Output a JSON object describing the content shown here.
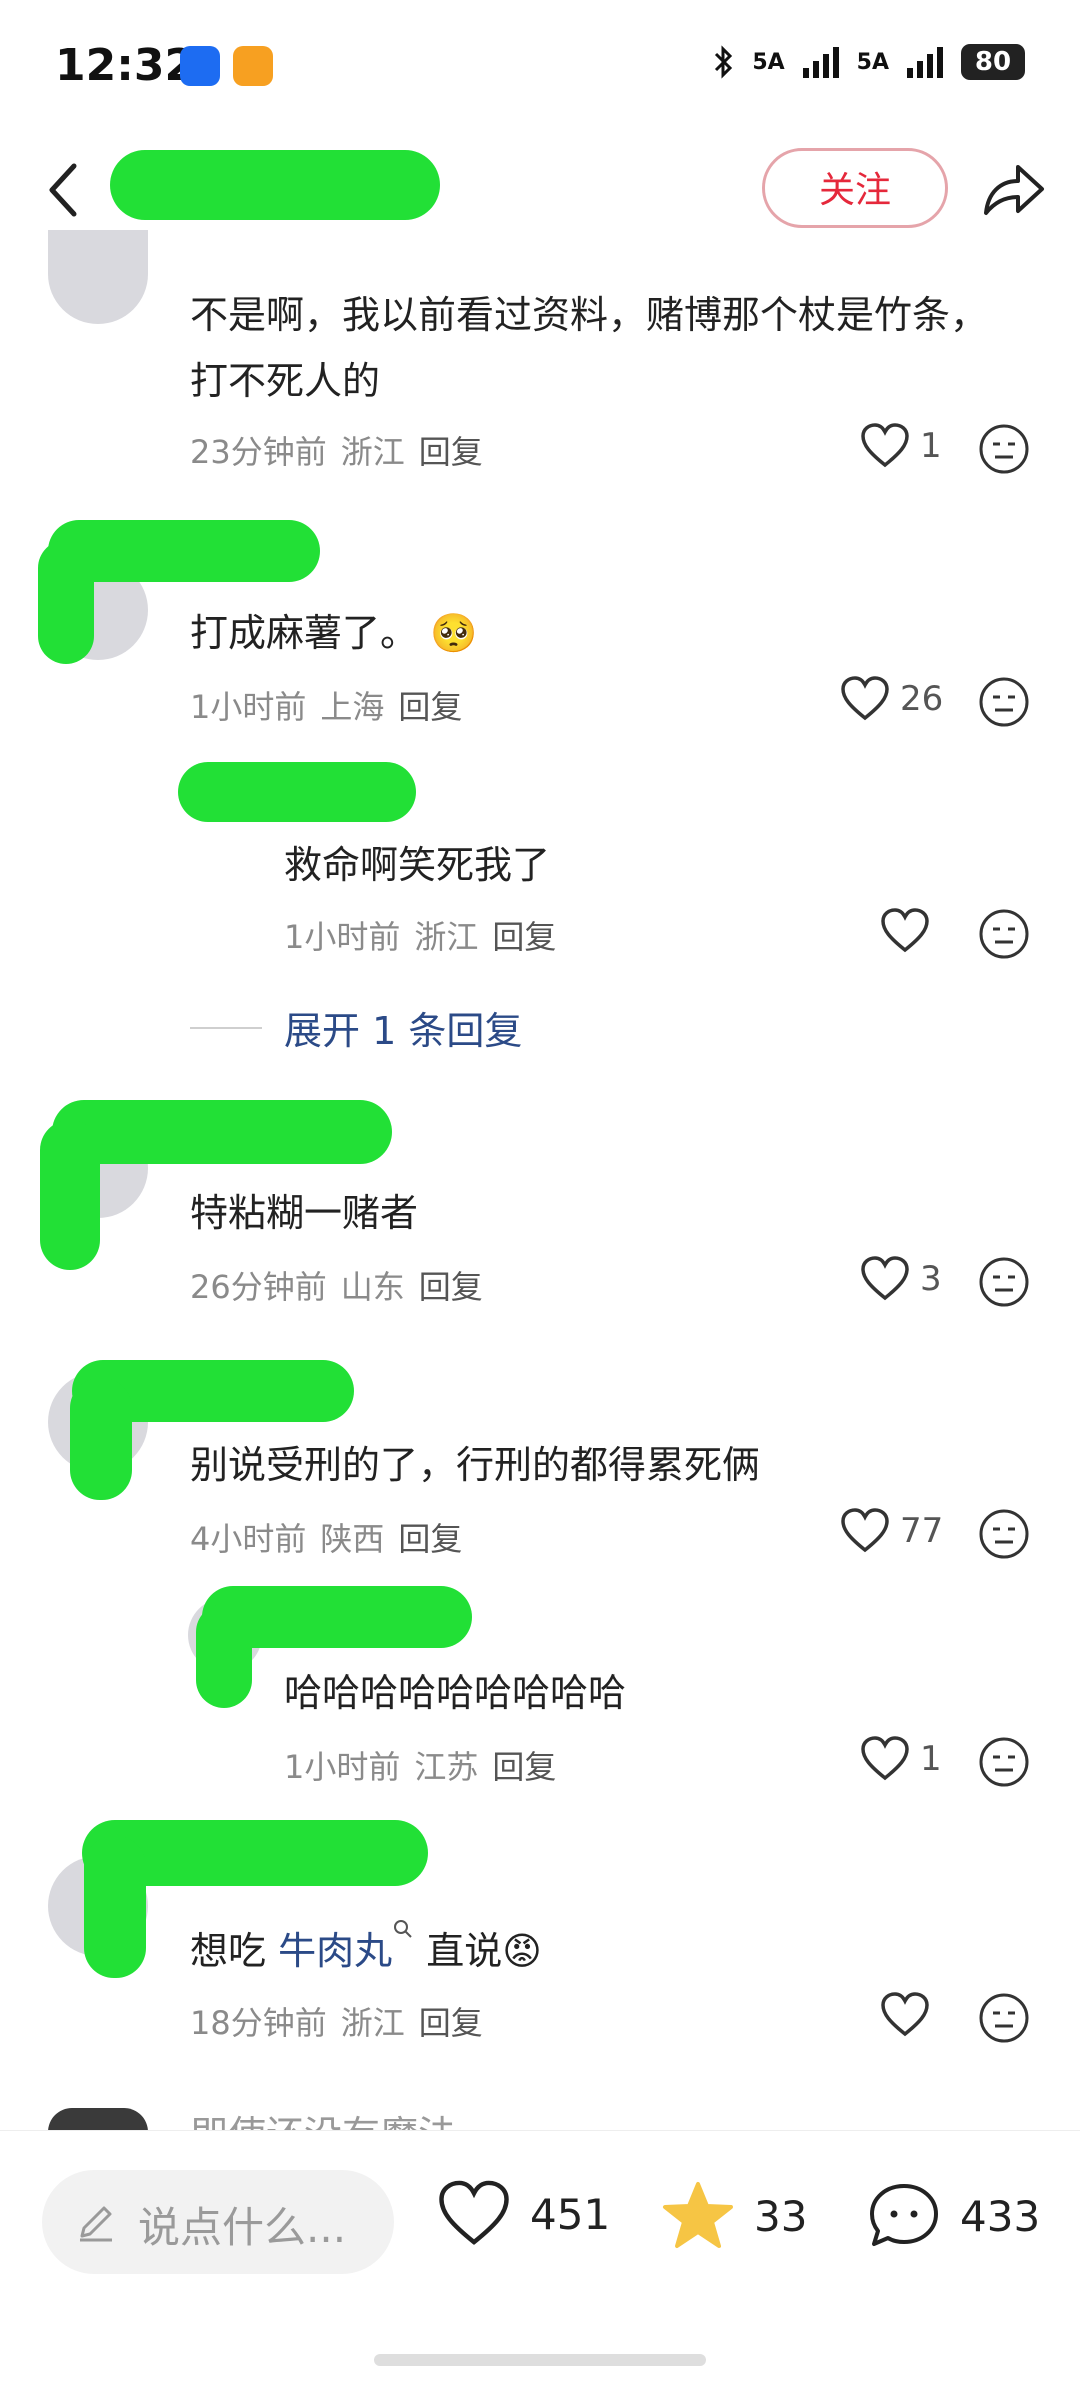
{
  "status_bar": {
    "time": "12:32",
    "net1": "5A",
    "net2": "5A",
    "battery": "80"
  },
  "header": {
    "follow_label": "关注"
  },
  "comments": [
    {
      "text": "不是啊，我以前看过资料，赌博那个杖是竹条，打不死人的",
      "time": "23分钟前",
      "location": "浙江",
      "reply": "回复",
      "likes": "1"
    },
    {
      "text": "打成麻薯了。",
      "emoji": "🥺",
      "time": "1小时前",
      "location": "上海",
      "reply": "回复",
      "likes": "26"
    },
    {
      "text": "救命啊笑死我了",
      "time": "1小时前",
      "location": "浙江",
      "reply": "回复",
      "likes": ""
    },
    {
      "text": "特粘糊一赌者",
      "time": "26分钟前",
      "location": "山东",
      "reply": "回复",
      "likes": "3"
    },
    {
      "text": "别说受刑的了，行刑的都得累死俩",
      "time": "4小时前",
      "location": "陕西",
      "reply": "回复",
      "likes": "77"
    },
    {
      "text": "哈哈哈哈哈哈哈哈哈",
      "time": "1小时前",
      "location": "江苏",
      "reply": "回复",
      "likes": "1"
    },
    {
      "text_before": "想吃",
      "link": "牛肉丸",
      "text_after": "直说",
      "emoji": "😡",
      "time": "18分钟前",
      "location": "浙江",
      "reply": "回复",
      "likes": ""
    }
  ],
  "expand_replies": "展开 1 条回复",
  "partial_comment": "即使还没有魔法",
  "bottom_bar": {
    "input_placeholder": "说点什么...",
    "likes": "451",
    "favorites": "33",
    "comments": "433"
  },
  "colors": {
    "accent_red": "#e5283b",
    "link_blue": "#2b4a87",
    "redaction_green": "#22e036",
    "star_yellow": "#f6c544"
  }
}
